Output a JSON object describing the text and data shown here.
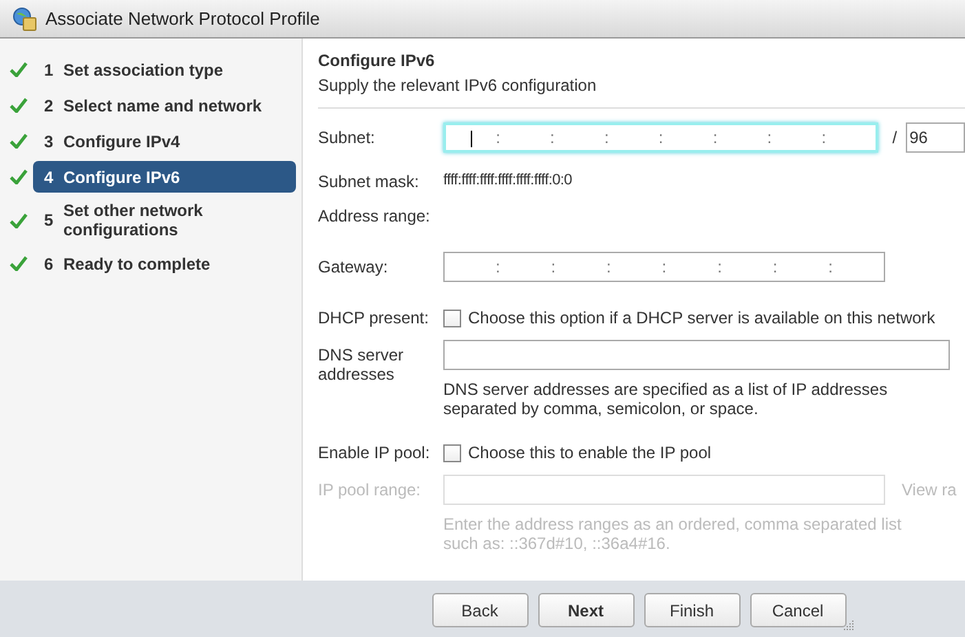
{
  "window": {
    "title": "Associate Network Protocol Profile"
  },
  "steps": [
    {
      "number": "1",
      "label": "Set association type",
      "completed": true,
      "selected": false
    },
    {
      "number": "2",
      "label": "Select name and network",
      "completed": true,
      "selected": false
    },
    {
      "number": "3",
      "label": "Configure IPv4",
      "completed": true,
      "selected": false
    },
    {
      "number": "4",
      "label": "Configure IPv6",
      "completed": true,
      "selected": true
    },
    {
      "number": "5",
      "label": "Set other network configurations",
      "completed": true,
      "selected": false
    },
    {
      "number": "6",
      "label": "Ready to complete",
      "completed": true,
      "selected": false
    }
  ],
  "page": {
    "title": "Configure IPv6",
    "subtitle": "Supply the relevant IPv6 configuration"
  },
  "form": [
    {
      "kind": "ipv6",
      "label": "Subnet:",
      "separators": [
        ":",
        ":",
        ":",
        ":",
        ":",
        ":",
        ":"
      ],
      "focused": true,
      "prefix_separator": "/",
      "prefix": "96"
    },
    {
      "kind": "text",
      "label": "Subnet mask:",
      "value": "ffff:ffff:ffff:ffff:ffff:ffff:0:0"
    },
    {
      "kind": "text",
      "label": "Address range:"
    },
    {
      "kind": "ipv6",
      "label": "Gateway:",
      "separators": [
        ":",
        ":",
        ":",
        ":",
        ":",
        ":",
        ":"
      ],
      "focused": false
    },
    {
      "kind": "checkbox",
      "label": "DHCP present:",
      "text": "Choose this option if a DHCP server is available on this network",
      "checked": false
    },
    {
      "kind": "input",
      "label": "DNS server addresses",
      "hint": "DNS server addresses are specified as a list of IP addresses separated by comma, semicolon, or space.",
      "disabled": false
    },
    {
      "kind": "checkbox",
      "label": "Enable IP pool:",
      "text": "Choose this to enable the IP pool",
      "checked": false
    },
    {
      "kind": "input",
      "label": "IP pool range:",
      "link": "View ra",
      "hint": "Enter the address ranges as an ordered, comma separated list such as: ::367d#10, ::36a4#16.",
      "disabled": true
    }
  ],
  "buttons": [
    {
      "label": "Back",
      "default": false
    },
    {
      "label": "Next",
      "default": true
    },
    {
      "label": "Finish",
      "default": false
    },
    {
      "label": "Cancel",
      "default": false
    }
  ]
}
